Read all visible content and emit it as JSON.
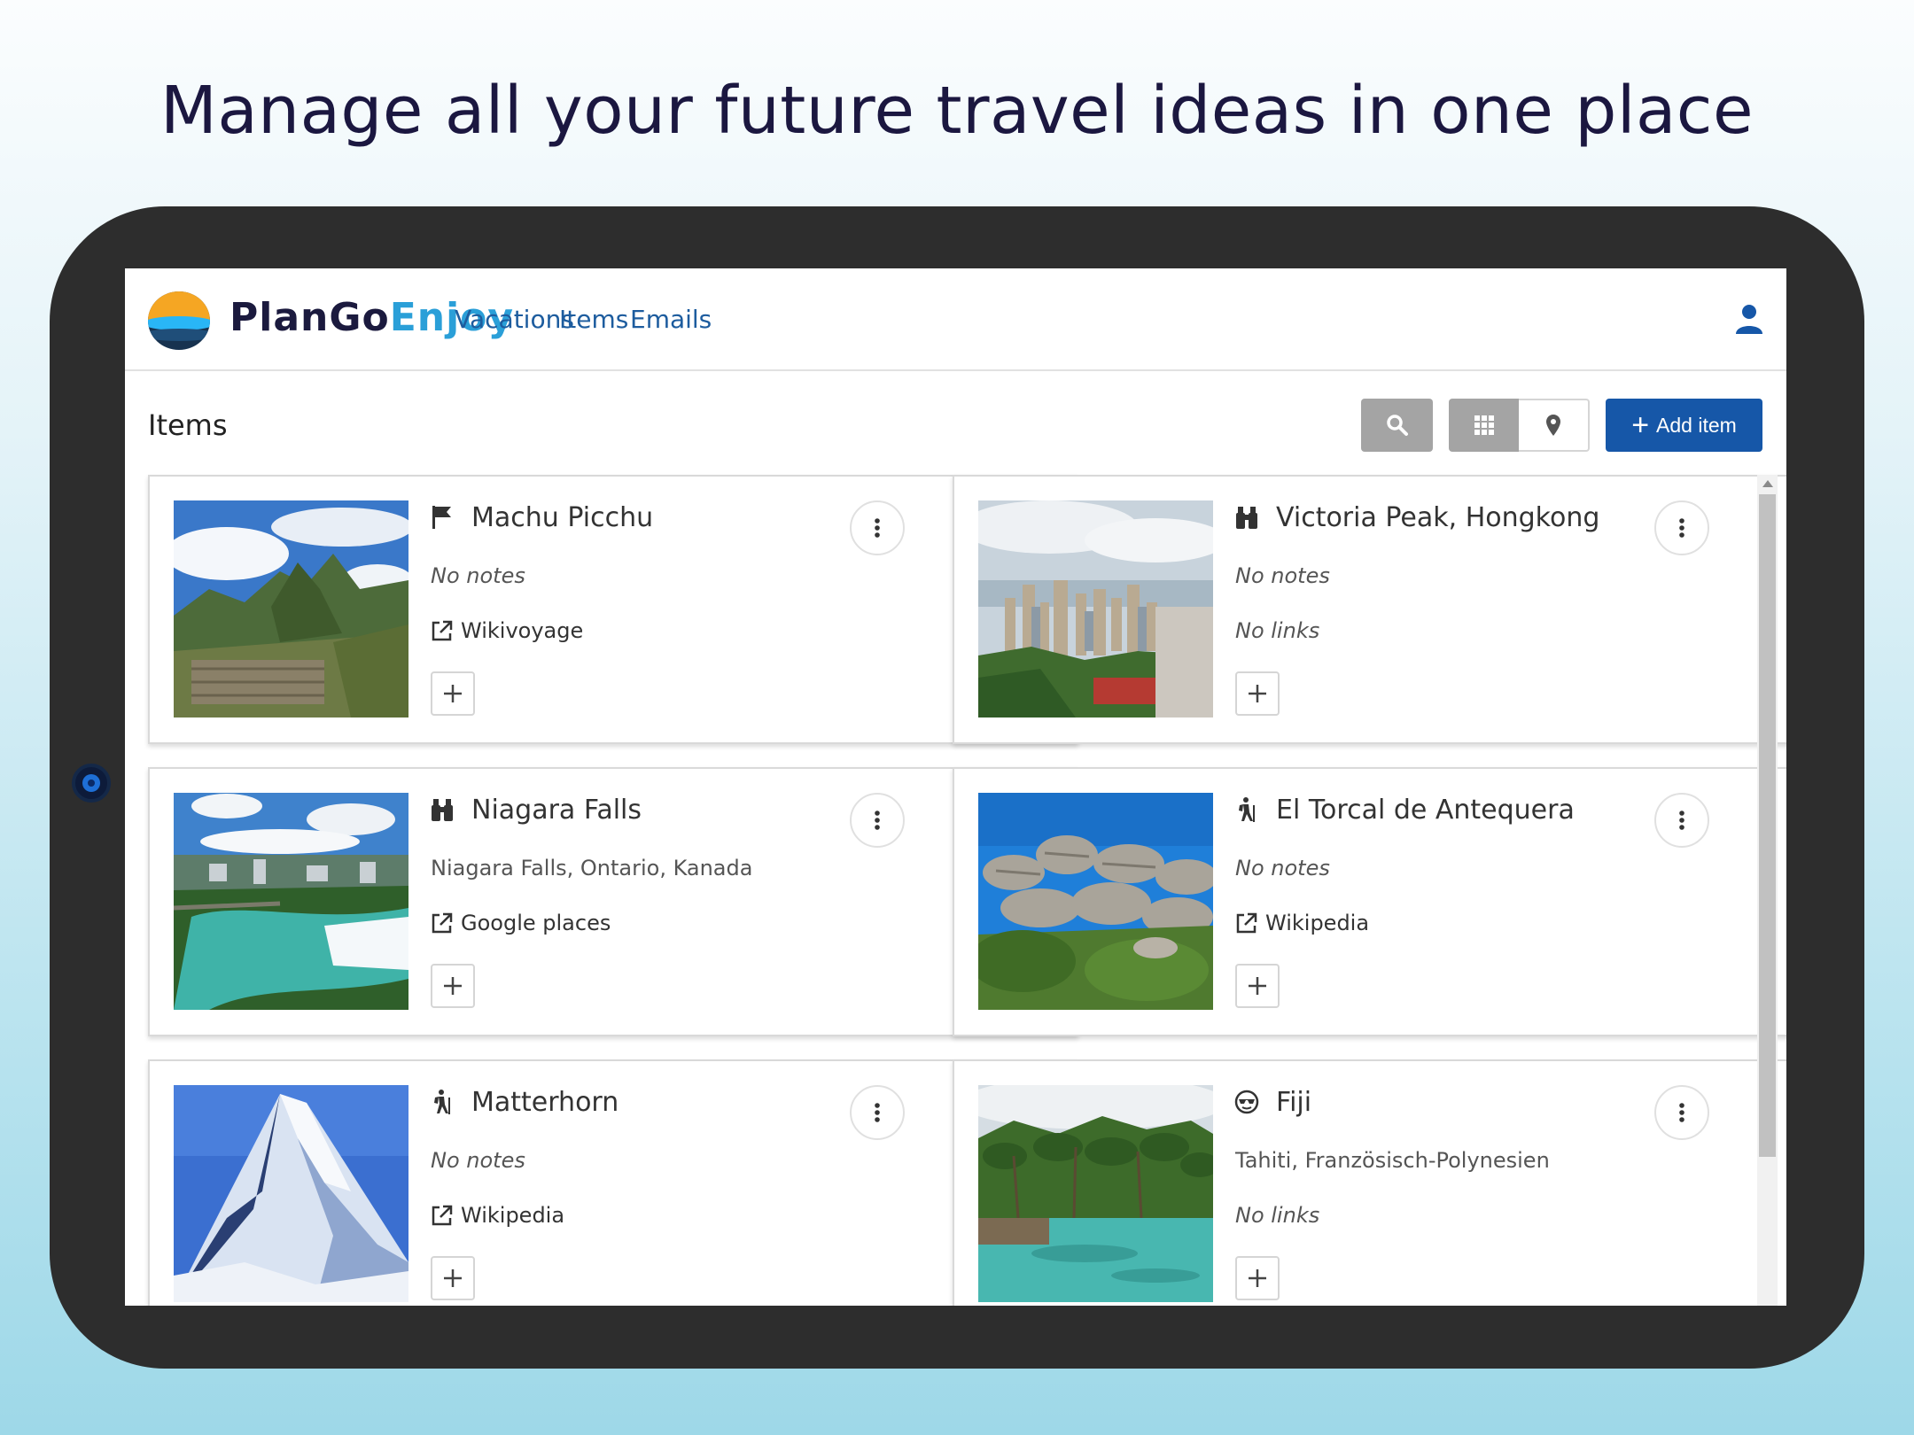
{
  "headline": "Manage all your future travel ideas in one place",
  "app": {
    "brand_part1": "PlanGo",
    "brand_part2": "Enjoy",
    "nav": [
      {
        "label": "Vacations"
      },
      {
        "label": "Items"
      },
      {
        "label": "Emails"
      }
    ],
    "user_icon": "user-icon"
  },
  "toolbar": {
    "page_title": "Items",
    "search_icon": "search-icon",
    "grid_icon": "grid-icon",
    "map_icon": "map-pin-icon",
    "add_label": "Add item"
  },
  "items": [
    {
      "title": "Machu Picchu",
      "category_icon": "flag-icon",
      "notes": "No notes",
      "link": "Wikivoyage",
      "has_link": true
    },
    {
      "title": "Victoria Peak, Hongkong",
      "category_icon": "binoculars-icon",
      "notes": "No notes",
      "link": "No links",
      "has_link": false
    },
    {
      "title": "Niagara Falls",
      "category_icon": "binoculars-icon",
      "notes": "Niagara Falls, Ontario, Kanada",
      "link": "Google places",
      "has_link": true
    },
    {
      "title": "El Torcal de Antequera",
      "category_icon": "hiking-icon",
      "notes": "No notes",
      "link": "Wikipedia",
      "has_link": true
    },
    {
      "title": "Matterhorn",
      "category_icon": "hiking-icon",
      "notes": "No notes",
      "link": "Wikipedia",
      "has_link": true
    },
    {
      "title": "Fiji",
      "category_icon": "sunglasses-icon",
      "notes": "Tahiti, Französisch-Polynesien",
      "link": "No links",
      "has_link": false
    }
  ],
  "colors": {
    "brand_dark": "#1b1a3e",
    "brand_accent": "#2a9fd8",
    "nav_link": "#1d5c9e",
    "primary_button": "#1657a8"
  }
}
